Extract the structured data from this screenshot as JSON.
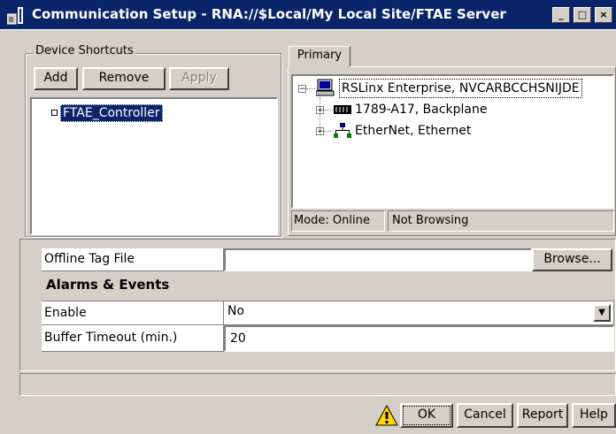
{
  "window": {
    "title": "Communication Setup - RNA://$Local/My Local Site/FTAE Server",
    "buttons": {
      "minimize": "_",
      "maximize": "□",
      "close": "×"
    }
  },
  "shortcuts": {
    "legend": "Device Shortcuts",
    "add_label": "Add",
    "remove_label": "Remove",
    "apply_label": "Apply",
    "items": [
      {
        "label": "FTAE_Controller",
        "selected": true
      }
    ]
  },
  "primary": {
    "tab_label": "Primary",
    "tree": {
      "root": "RSLinx Enterprise, NVCARBCCHSNIJDE",
      "children": [
        {
          "label": "1789-A17, Backplane",
          "icon": "backplane-icon"
        },
        {
          "label": "EtherNet, Ethernet",
          "icon": "network-icon"
        }
      ]
    },
    "status": {
      "mode": "Mode: Online",
      "browsing": "Not Browsing"
    }
  },
  "properties": {
    "offline_tag_label": "Offline Tag File",
    "offline_tag_value": "",
    "browse_label": "Browse...",
    "alarms_header": "Alarms & Events",
    "enable_label": "Enable",
    "enable_value": "No",
    "buffer_label": "Buffer Timeout (min.)",
    "buffer_value": "20"
  },
  "footer": {
    "warning_icon": "warning-icon",
    "ok_label": "OK",
    "cancel_label": "Cancel",
    "report_label": "Report",
    "help_label": "Help"
  },
  "colors": {
    "titlebar": "#0a246a",
    "selection": "#0a246a",
    "face": "#d4d0c8"
  }
}
